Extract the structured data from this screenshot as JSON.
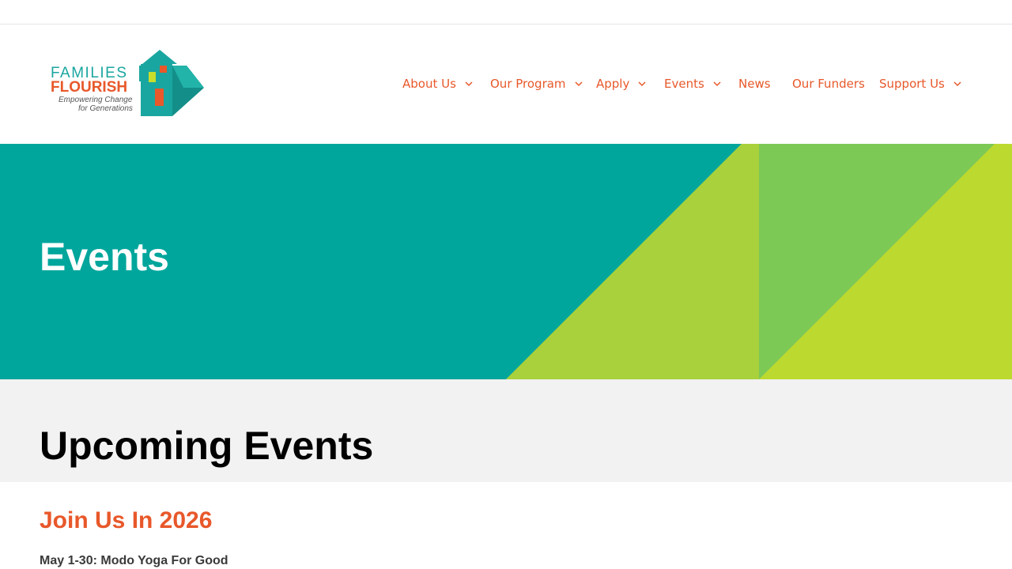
{
  "logo": {
    "line1": "FAMILIES",
    "line2": "FLOURISH",
    "tagline1": "Empowering Change",
    "tagline2": "for Generations"
  },
  "nav": {
    "items": [
      {
        "label": "About Us",
        "has_dropdown": true
      },
      {
        "label": "Our Program",
        "has_dropdown": true
      },
      {
        "label": "Apply",
        "has_dropdown": true
      },
      {
        "label": "Events",
        "has_dropdown": true
      },
      {
        "label": "News",
        "has_dropdown": false
      },
      {
        "label": "Our Funders",
        "has_dropdown": false
      },
      {
        "label": "Support Us",
        "has_dropdown": true
      }
    ]
  },
  "hero": {
    "title": "Events"
  },
  "section": {
    "title": "Upcoming Events"
  },
  "content": {
    "heading": "Join Us In 2026",
    "event": "May 1-30: Modo Yoga For Good"
  },
  "colors": {
    "accent": "#e8582a",
    "teal": "#00a69c",
    "lime": "#bcd92f",
    "green": "#7dc956",
    "band": "#f2f2f2"
  },
  "icons": {
    "dropdown": "chevron-down-icon",
    "logo": "house-logo-icon"
  }
}
